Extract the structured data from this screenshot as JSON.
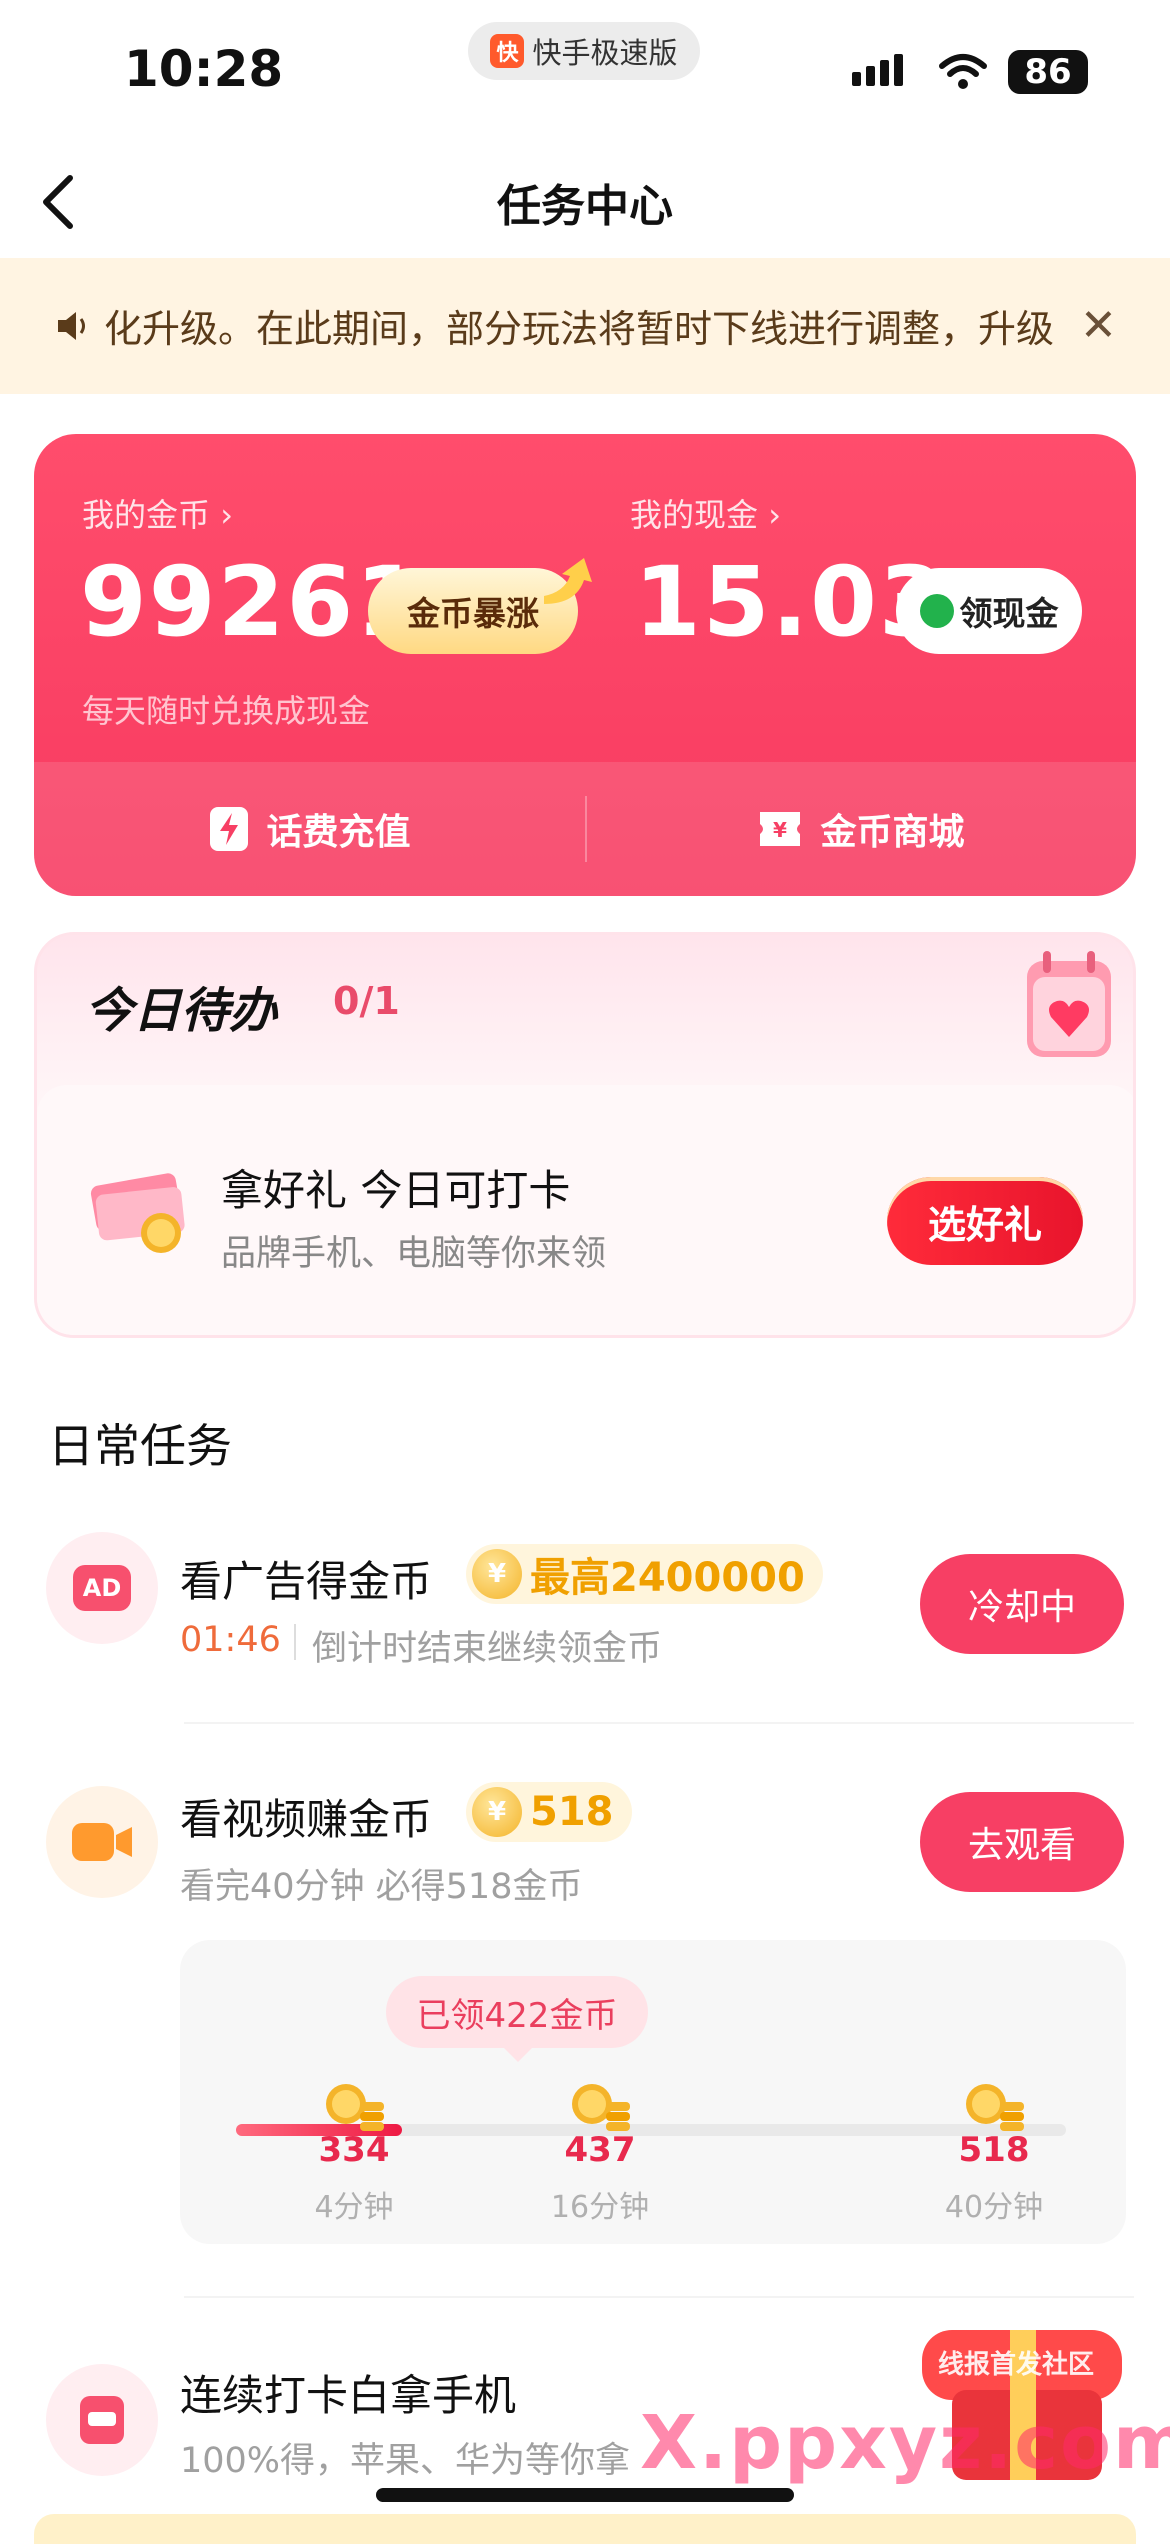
{
  "status_bar": {
    "time": "10:28",
    "app_name": "快手极速版",
    "battery": "86"
  },
  "nav": {
    "title": "任务中心"
  },
  "banner": {
    "text": "化升级。在此期间，部分玩法将暂时下线进行调整，升级"
  },
  "wallet": {
    "coins_label": "我的金币",
    "coins_value": "99261",
    "coins_button": "金币暴涨",
    "coins_hint": "每天随时兑换成现金",
    "cash_label": "我的现金",
    "cash_value": "15.03",
    "cash_button": "领现金",
    "recharge_label": "话费充值",
    "mall_label": "金币商城"
  },
  "todo": {
    "title": "今日待办",
    "count": "0/1",
    "item_title": "拿好礼 今日可打卡",
    "item_sub": "品牌手机、电脑等你来领",
    "button": "选好礼"
  },
  "daily": {
    "section_title": "日常任务",
    "ad_task": {
      "name": "看广告得金币",
      "reward": "最高2400000",
      "countdown": "01:46",
      "sub": "倒计时结束继续领金币",
      "button": "冷却中",
      "icon_text": "AD"
    },
    "video_task": {
      "name": "看视频赚金币",
      "reward": "518",
      "sub": "看完40分钟 必得518金币",
      "button": "去观看",
      "claimed": "已领422金币",
      "progress_fraction": 0.2,
      "milestones": [
        {
          "value": "334",
          "time": "4分钟"
        },
        {
          "value": "437",
          "time": "16分钟"
        },
        {
          "value": "518",
          "time": "40分钟"
        }
      ]
    },
    "checkin_task": {
      "name": "连续打卡白拿手机",
      "sub": "100%得，苹果、华为等你拿"
    }
  },
  "watermark": {
    "text": "X.ppxyz.com",
    "small": "线报首发社区"
  },
  "colors": {
    "accent": "#f73f64",
    "coin": "#f0a000",
    "banner_bg": "#fff4e2"
  }
}
